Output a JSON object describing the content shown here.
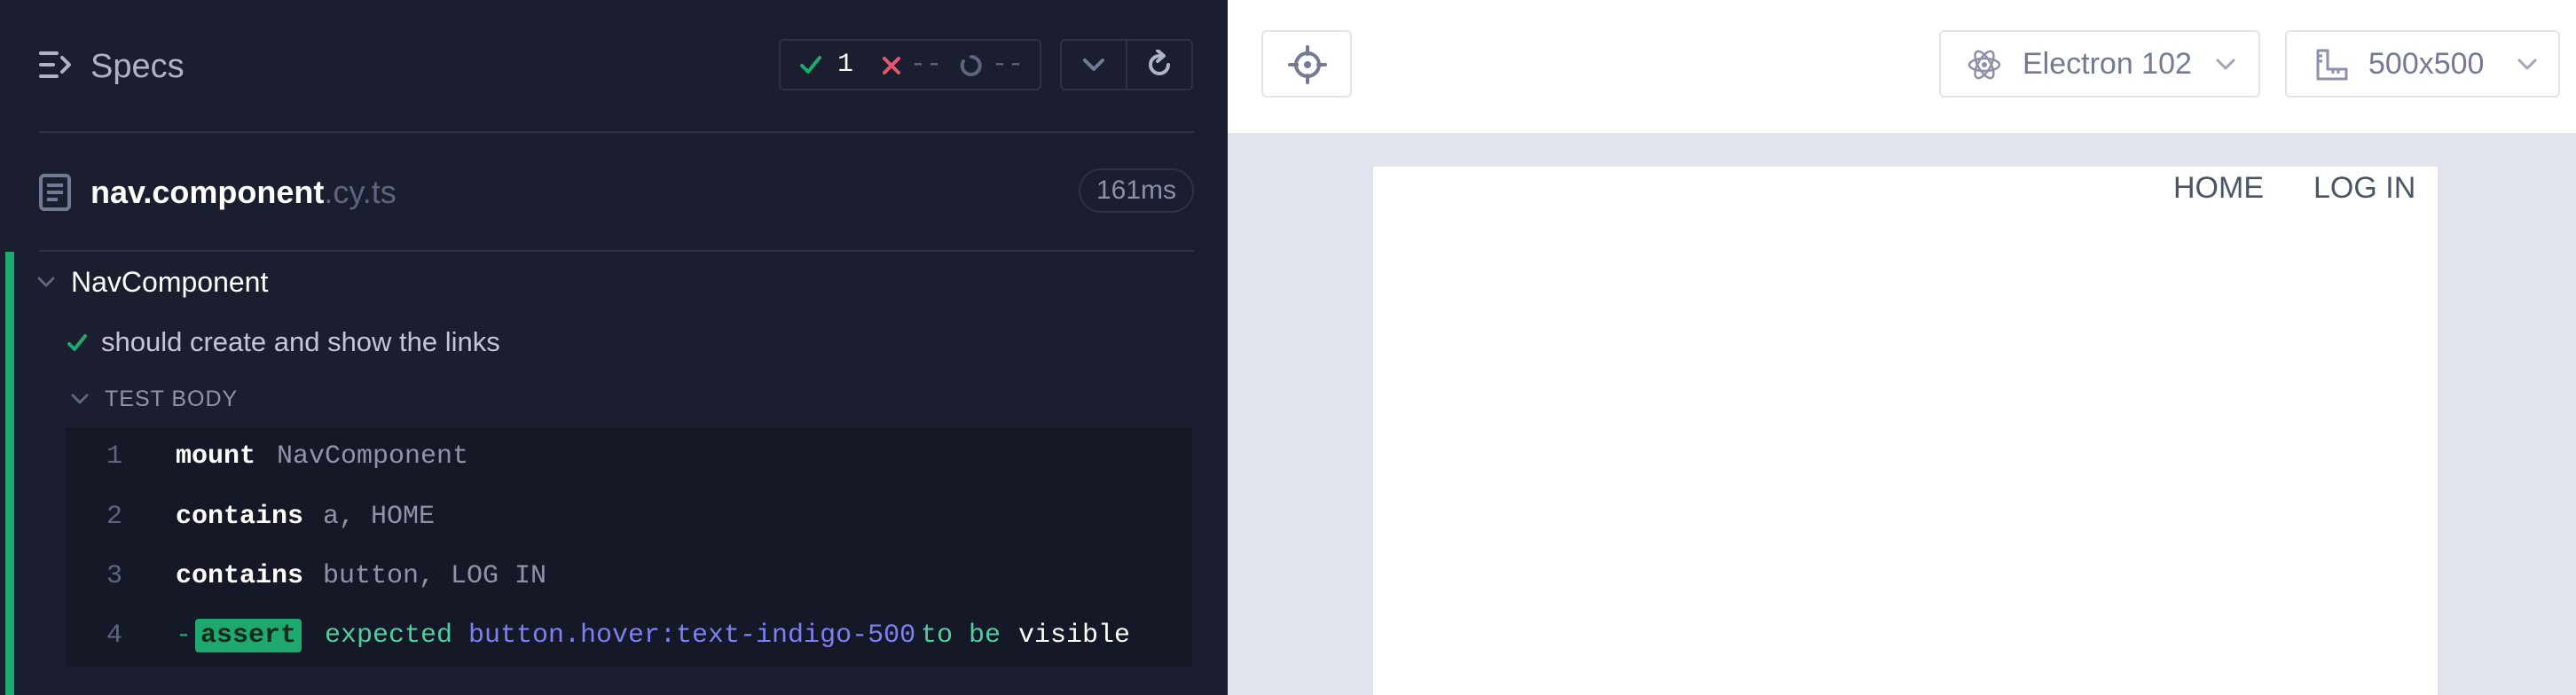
{
  "header": {
    "title": "Specs",
    "stats": {
      "passed": "1",
      "failed": "--",
      "pending": "--"
    }
  },
  "file": {
    "name": "nav.component",
    "extension": ".cy.ts",
    "duration": "161ms"
  },
  "suite": {
    "title": "NavComponent"
  },
  "test": {
    "title": "should create and show the links",
    "body_label": "TEST BODY"
  },
  "commands": [
    {
      "num": "1",
      "name": "mount",
      "message": "NavComponent"
    },
    {
      "num": "2",
      "name": "contains",
      "message": "a, HOME"
    },
    {
      "num": "3",
      "name": "contains",
      "message": "button, LOG IN"
    },
    {
      "num": "4",
      "dash": "-",
      "name": "assert",
      "words": [
        "expected",
        "button.hover:text-indigo-500",
        "to be",
        "visible"
      ]
    }
  ],
  "browser": {
    "label": "Electron 102"
  },
  "viewport": {
    "label": "500x500"
  },
  "aut": {
    "links": [
      "HOME",
      "LOG IN"
    ]
  },
  "colors": {
    "passed": "#1fa971",
    "failed": "#e45770",
    "indigo": "#7f7ff4",
    "sidebar_bg": "#1b1e2e"
  },
  "icons": [
    "menu-expand-icon",
    "check-icon",
    "x-icon",
    "pending-icon",
    "chevron-down-icon",
    "refresh-icon",
    "document-icon",
    "crosshair-icon",
    "electron-icon",
    "ruler-icon"
  ]
}
